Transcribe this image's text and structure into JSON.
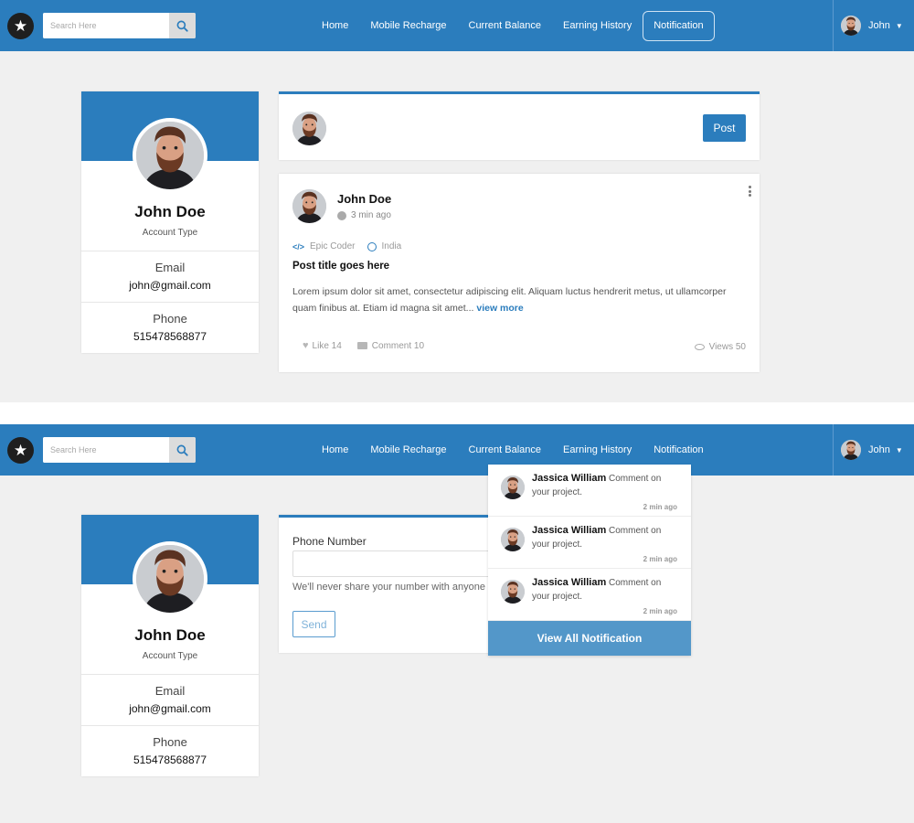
{
  "navbar": {
    "search_placeholder": "Search Here",
    "links": [
      "Home",
      "Mobile Recharge",
      "Current Balance",
      "Earning History",
      "Notification"
    ],
    "user_name": "John"
  },
  "profile": {
    "name": "John Doe",
    "account_type": "Account Type",
    "email_label": "Email",
    "email": "john@gmail.com",
    "phone_label": "Phone",
    "phone": "515478568877"
  },
  "composer": {
    "post_button": "Post"
  },
  "post": {
    "author": "John Doe",
    "time": "3 min ago",
    "category": "Epic Coder",
    "location": "India",
    "title": "Post title goes here",
    "body": "Lorem ipsum dolor sit amet, consectetur adipiscing elit. Aliquam luctus hendrerit metus, ut ullamcorper quam finibus at. Etiam id magna sit amet...",
    "view_more": "view more",
    "likes": "Like 14",
    "comments": "Comment 10",
    "views": "Views 50"
  },
  "form": {
    "phone_label": "Phone Number",
    "help_text": "We'll never share your number with anyone else.",
    "send_button": "Send"
  },
  "notifications": {
    "items": [
      {
        "name": "Jassica William",
        "action": "Comment on",
        "text": "your project.",
        "time": "2 min ago"
      },
      {
        "name": "Jassica William",
        "action": "Comment on",
        "text": "your project.",
        "time": "2 min ago"
      },
      {
        "name": "Jassica William",
        "action": "Comment on",
        "text": "your project.",
        "time": "2 min ago"
      }
    ],
    "footer": "View All Notification"
  },
  "colors": {
    "primary": "#2b7dbd",
    "notif_footer": "#5397c9",
    "background": "#f0f0f0"
  },
  "icons": [
    "star-icon",
    "search-icon",
    "caret-down-icon",
    "clock-icon",
    "kebab-icon",
    "code-icon",
    "compass-icon",
    "heart-icon",
    "comment-icon",
    "eye-icon"
  ]
}
